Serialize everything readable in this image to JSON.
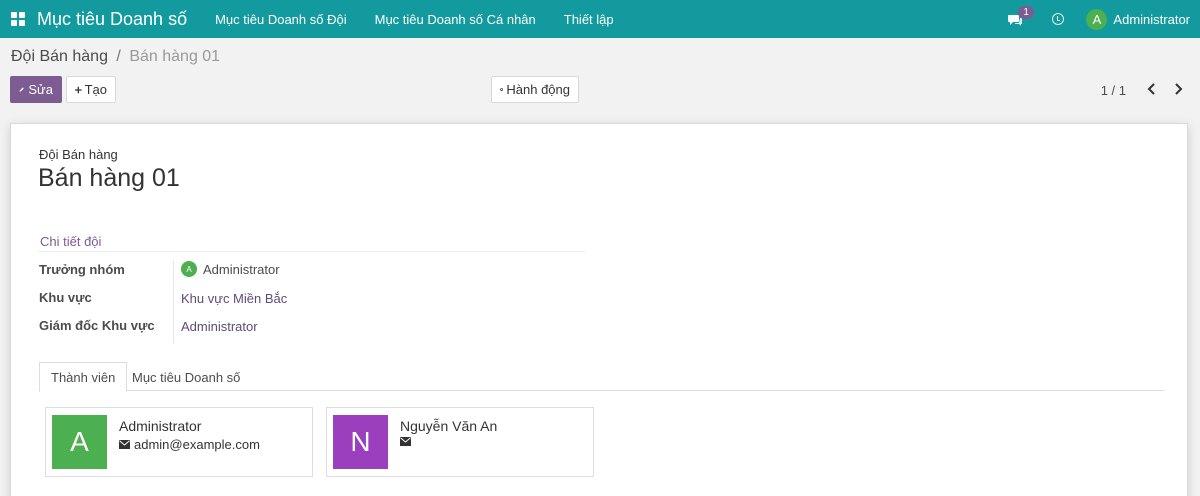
{
  "topbar": {
    "brand": "Mục tiêu Doanh số",
    "menu": [
      "Mục tiêu Doanh số Đội",
      "Mục tiêu Doanh số Cá nhân",
      "Thiết lập"
    ],
    "chat_count": "1",
    "user_initial": "A",
    "user_name": "Administrator"
  },
  "breadcrumb": {
    "parent": "Đội Bán hàng",
    "separator": "/",
    "current": "Bán hàng 01"
  },
  "toolbar": {
    "edit_label": "Sửa",
    "create_label": "Tạo",
    "action_label": "Hành động"
  },
  "pager": {
    "value": "1 / 1"
  },
  "record": {
    "label": "Đội Bán hàng",
    "title": "Bán hàng 01",
    "group_title": "Chi tiết đội",
    "fields": [
      {
        "label": "Trưởng nhóm",
        "value": "Administrator",
        "avatar": "A"
      },
      {
        "label": "Khu vực",
        "value": "Khu vực Miền Bắc"
      },
      {
        "label": "Giám đốc Khu vực",
        "value": "Administrator"
      }
    ]
  },
  "tabs": [
    "Thành viên",
    "Mục tiêu Doanh số"
  ],
  "members": [
    {
      "initial": "A",
      "name": "Administrator",
      "email": "admin@example.com",
      "color": "#4caf50"
    },
    {
      "initial": "N",
      "name": "Nguyễn Văn An",
      "email": "",
      "color": "#9b3fbf"
    }
  ],
  "colors": {
    "primary": "#7c5c92",
    "topbar": "#139a9e"
  }
}
